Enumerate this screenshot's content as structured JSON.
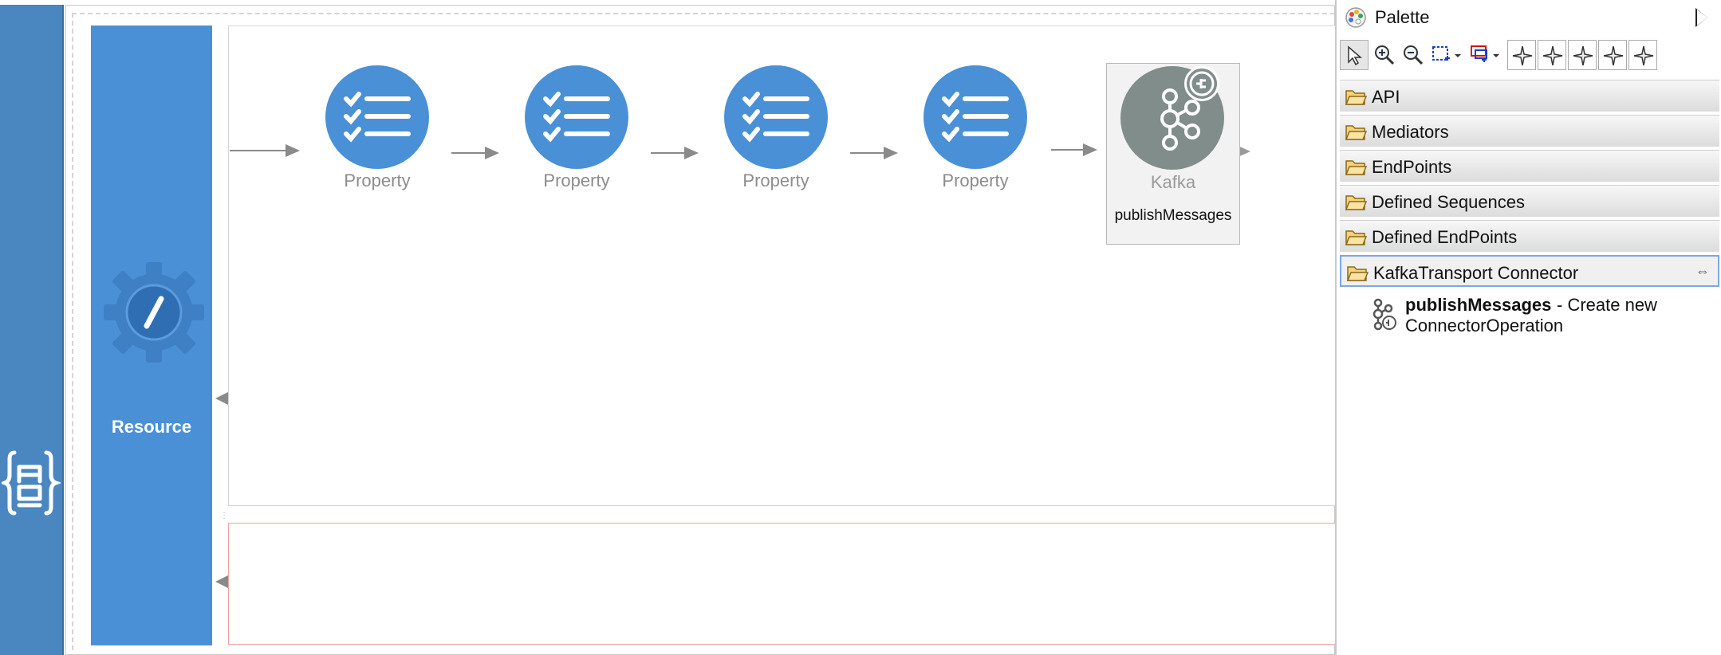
{
  "api_strip": {
    "logo_text": "{API}"
  },
  "resource": {
    "label": "Resource"
  },
  "flow": [
    {
      "name": "Property"
    },
    {
      "name": "Property"
    },
    {
      "name": "Property"
    },
    {
      "name": "Property"
    }
  ],
  "connector_node": {
    "label": "Kafka",
    "operation": "publishMessages"
  },
  "palette": {
    "title": "Palette",
    "tools": [
      "select-tool",
      "zoom-in-tool",
      "zoom-out-tool",
      "marquee-tool",
      "connection-creation-tool",
      "align-tool-1",
      "align-tool-2",
      "align-tool-3",
      "align-tool-4",
      "align-tool-5"
    ],
    "drawers": [
      {
        "label": "API"
      },
      {
        "label": "Mediators"
      },
      {
        "label": "EndPoints"
      },
      {
        "label": "Defined Sequences"
      },
      {
        "label": "Defined EndPoints"
      },
      {
        "label": "KafkaTransport Connector"
      }
    ],
    "entry": {
      "name": "publishMessages",
      "description_line1": "- Create new",
      "description_line2": "ConnectorOperation"
    }
  },
  "colors": {
    "accent_blue": "#4a90d6",
    "api_strip": "#4a86c0",
    "connector_gray": "#808d8b",
    "fault_border": "#f2a0a0"
  }
}
